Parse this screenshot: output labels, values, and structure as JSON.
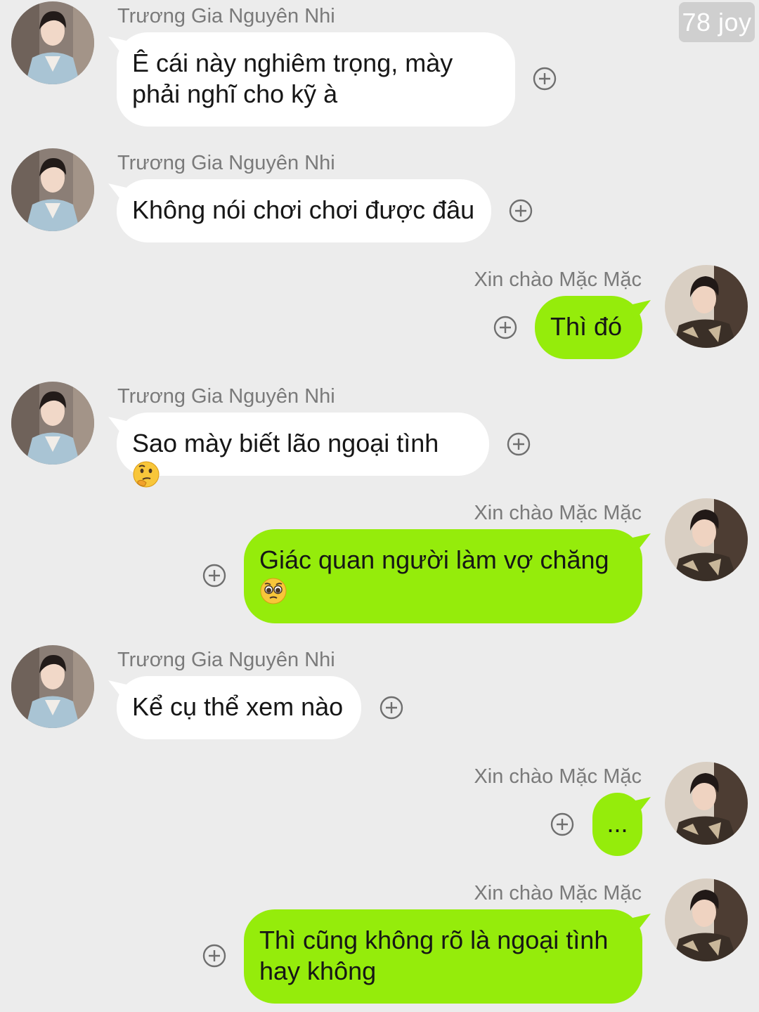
{
  "watermark": "78 joy",
  "contacts": {
    "other": "Trương Gia Nguyên Nhi",
    "self": "Xin chào Mặc Mặc"
  },
  "messages": [
    {
      "side": "in",
      "text": "Ê cái này nghiêm trọng, mày phải nghĩ cho kỹ à"
    },
    {
      "side": "in",
      "text": "Không nói chơi chơi được đâu"
    },
    {
      "side": "out",
      "text": "Thì đó"
    },
    {
      "side": "in",
      "text": "Sao mày biết lão ngoại tình",
      "emoji": "thinking-face"
    },
    {
      "side": "out",
      "text": "Giác quan người làm vợ chăng",
      "emoji": "pleading-face"
    },
    {
      "side": "in",
      "text": "Kể cụ thể xem nào"
    },
    {
      "side": "out",
      "text": "..."
    },
    {
      "side": "out",
      "text": "Thì cũng không rõ là ngoại tình hay không"
    }
  ],
  "colors": {
    "background": "#ececec",
    "incoming_bubble": "#ffffff",
    "outgoing_bubble": "#95ec0b",
    "name_text": "#7a7a7a"
  },
  "icons": {
    "plus": "circle-plus-icon",
    "thinking": "thinking-face-emoji",
    "pleading": "pleading-face-emoji"
  }
}
